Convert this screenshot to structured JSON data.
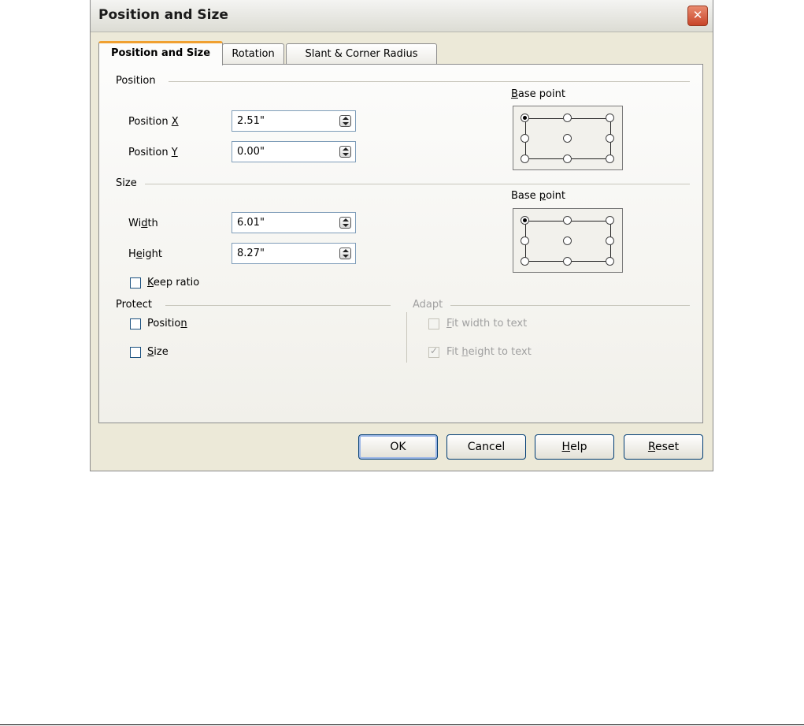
{
  "window": {
    "title": "Position and Size",
    "close_glyph": "✕"
  },
  "tabs": [
    {
      "label": "Position and Size",
      "active": true
    },
    {
      "label": "Rotation",
      "active": false
    },
    {
      "label": "Slant & Corner Radius",
      "active": false
    }
  ],
  "position": {
    "group_label": "Position",
    "x_label_pre": "Position ",
    "x_label_key": "X",
    "x_value": "2.51\"",
    "y_label_pre": "Position ",
    "y_label_key": "Y",
    "y_value": "0.00\"",
    "base_point_key": "B",
    "base_point_rest": "ase point"
  },
  "size": {
    "group_label": "Size",
    "width_pre": "Wi",
    "width_key": "d",
    "width_post": "th",
    "width_value": "6.01\"",
    "height_pre": "H",
    "height_key": "e",
    "height_post": "ight",
    "height_value": "8.27\"",
    "keep_ratio_key": "K",
    "keep_ratio_rest": "eep ratio",
    "base_point_pre": "Base ",
    "base_point_key": "p",
    "base_point_rest": "oint"
  },
  "protect": {
    "group_label": "Protect",
    "position_pre": "Positio",
    "position_key": "n",
    "size_key": "S",
    "size_rest": "ize"
  },
  "adapt": {
    "group_label": "Adapt",
    "fit_width_key": "F",
    "fit_width_rest": "it width to text",
    "fit_height_pre": "Fit ",
    "fit_height_key": "h",
    "fit_height_rest": "eight to text"
  },
  "buttons": {
    "ok": "OK",
    "cancel": "Cancel",
    "help_key": "H",
    "help_rest": "elp",
    "reset_key": "R",
    "reset_rest": "eset"
  }
}
